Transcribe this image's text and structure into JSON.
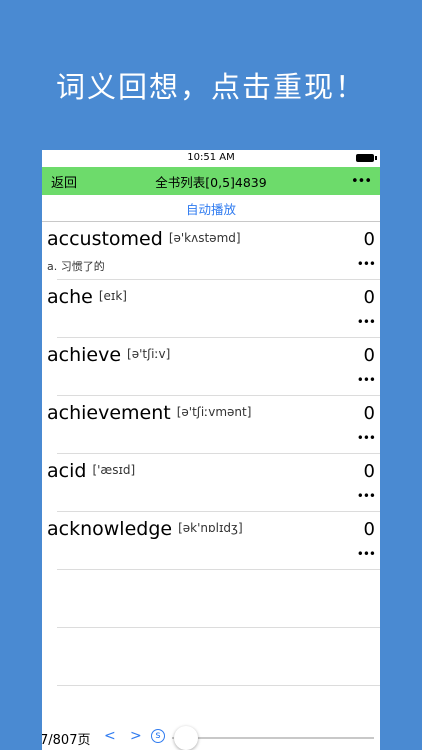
{
  "headline": "词义回想，点击重现！",
  "status": {
    "time": "10:51 AM"
  },
  "navbar": {
    "back": "返回",
    "title": "全书列表[0,5]4839",
    "more": "•••"
  },
  "autoplay": "自动播放",
  "words": [
    {
      "word": "accustomed",
      "phonetic": "[ə'kʌstəmd]",
      "count": "0",
      "meaning": "a. 习惯了的",
      "more": "•••"
    },
    {
      "word": "ache",
      "phonetic": "[eɪk]",
      "count": "0",
      "meaning": "",
      "more": "•••"
    },
    {
      "word": "achieve",
      "phonetic": "[ə'tʃiːv]",
      "count": "0",
      "meaning": "",
      "more": "•••"
    },
    {
      "word": "achievement",
      "phonetic": "[ə'tʃiːvmənt]",
      "count": "0",
      "meaning": "",
      "more": "•••"
    },
    {
      "word": "acid",
      "phonetic": "['æsɪd]",
      "count": "0",
      "meaning": "",
      "more": "•••"
    },
    {
      "word": "acknowledge",
      "phonetic": "[ək'nɒlɪdʒ]",
      "count": "0",
      "meaning": "",
      "more": "•••"
    }
  ],
  "bottom": {
    "page": "7/807页",
    "prev": "<",
    "next": ">",
    "s_icon": "ⓢ"
  },
  "colors": {
    "background": "#4a8ad2",
    "navbar": "#6ddb6b",
    "accent": "#2f7bf0"
  }
}
